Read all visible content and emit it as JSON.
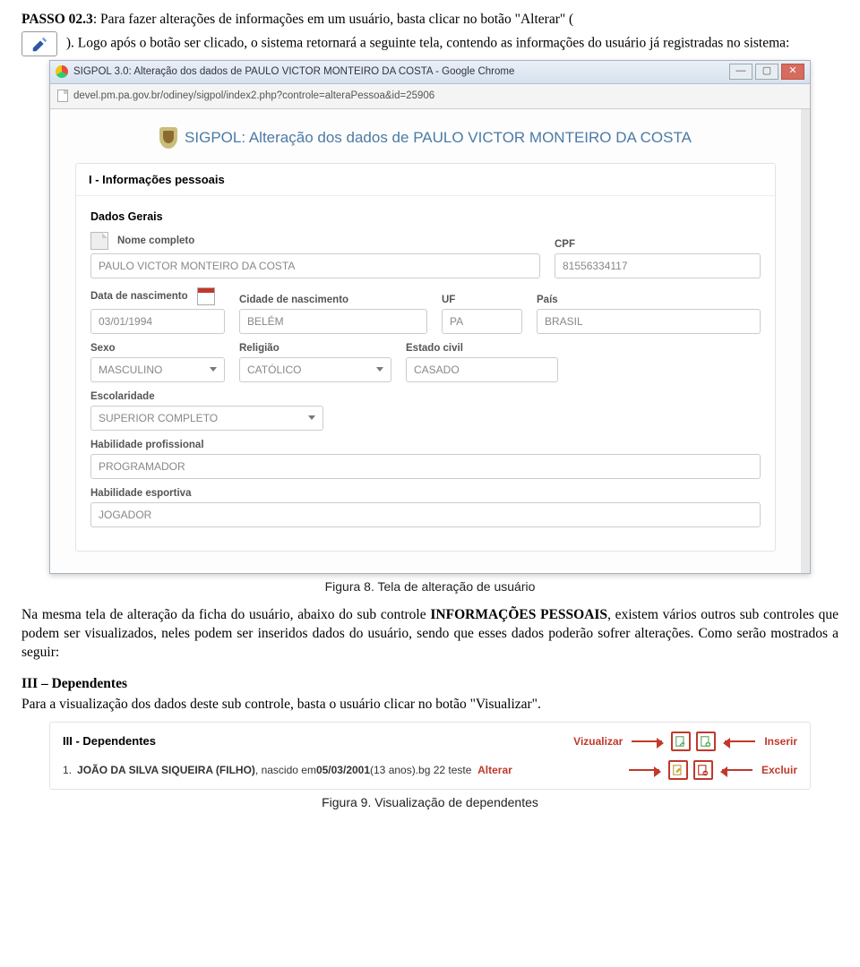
{
  "step": {
    "label": "PASSO 02.3",
    "desc1": "Para fazer alterações de informações em um usuário, basta clicar no botão \"Alterar\" (",
    "desc2": "). Logo após o botão ser clicado, o sistema retornará a seguinte tela, contendo as informações do usuário já registradas no sistema:"
  },
  "fig8_caption": "Figura 8. Tela de alteração de usuário",
  "chrome": {
    "title": "SIGPOL 3.0: Alteração dos dados de PAULO VICTOR MONTEIRO DA COSTA - Google Chrome",
    "url": "devel.pm.pa.gov.br/odiney/sigpol/index2.php?controle=alteraPessoa&id=25906",
    "page_title": "SIGPOL: Alteração dos dados de PAULO VICTOR MONTEIRO DA COSTA"
  },
  "form": {
    "section_title": "I - Informações pessoais",
    "dados_gerais": "Dados Gerais",
    "nome_lbl": "Nome completo",
    "nome_val": "PAULO VICTOR MONTEIRO DA COSTA",
    "cpf_lbl": "CPF",
    "cpf_val": "81556334117",
    "dnasc_lbl": "Data de nascimento",
    "dnasc_val": "03/01/1994",
    "cnasc_lbl": "Cidade de nascimento",
    "cnasc_val": "BELÉM",
    "uf_lbl": "UF",
    "uf_val": "PA",
    "pais_lbl": "País",
    "pais_val": "BRASIL",
    "sexo_lbl": "Sexo",
    "sexo_val": "MASCULINO",
    "rel_lbl": "Religião",
    "rel_val": "CATÓLICO",
    "ec_lbl": "Estado civil",
    "ec_val": "CASADO",
    "esc_lbl": "Escolaridade",
    "esc_val": "SUPERIOR COMPLETO",
    "hp_lbl": "Habilidade profissional",
    "hp_val": "PROGRAMADOR",
    "he_lbl": "Habilidade esportiva",
    "he_val": "JOGADOR"
  },
  "para2": {
    "t1": "Na mesma tela de alteração da ficha do usuário, abaixo do sub controle ",
    "t2": "INFORMAÇÕES PESSOAIS",
    "t3": ", existem vários outros sub controles que podem ser visualizados, neles podem ser inseridos dados do usuário, sendo que esses dados poderão sofrer alterações. Como serão mostrados a seguir:"
  },
  "dep": {
    "heading": "III – Dependentes",
    "intro": "Para a visualização dos dados deste sub controle, basta o usuário clicar no botão \"Visualizar\".",
    "panel_title": "III - Dependentes",
    "viz": "Vizualizar",
    "ins": "Inserir",
    "alt": "Alterar",
    "exc": "Excluir",
    "row_idx": "1.",
    "row_name": "JOÃO DA SILVA SIQUEIRA (FILHO)",
    "row_born_lbl": ", nascido em ",
    "row_born": "05/03/2001",
    "row_age": " (13 anos). ",
    "row_extra": "bg 22 teste"
  },
  "fig9_caption": "Figura 9. Visualização de dependentes"
}
